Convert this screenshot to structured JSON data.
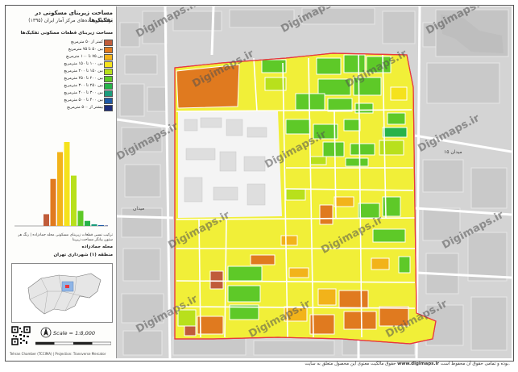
{
  "title": "مساحت زیربنای مسکونی در تفکیک‌ها",
  "subtitle": "بر اساس داده‌های مرکز آمار ایران (۱۳۹۵)",
  "legend": {
    "heading": "مساحت زیربنای قطعات مسکونی تفکیک‌ها",
    "items": [
      {
        "label": "کمتر از ۵۰ مترمربع",
        "color": "#c05c3a"
      },
      {
        "label": "بین ۵۰ تا ۷۵ مترمربع",
        "color": "#e07a1f"
      },
      {
        "label": "بین ۷۵ تا ۱۰۰ مترمربع",
        "color": "#f2b31a"
      },
      {
        "label": "بین ۱۰۰ تا ۱۵۰ مترمربع",
        "color": "#f5e21c"
      },
      {
        "label": "بین ۱۵۰ تا ۲۰۰ مترمربع",
        "color": "#b8e01c"
      },
      {
        "label": "بین ۲۰۰ تا ۲۵۰ مترمربع",
        "color": "#5ec928"
      },
      {
        "label": "بین ۲۵۰ تا ۳۰۰ مترمربع",
        "color": "#27b34a"
      },
      {
        "label": "بین ۳۰۰ تا ۴۰۰ مترمربع",
        "color": "#1a9c7c"
      },
      {
        "label": "بین ۴۰۰ تا ۵۰۰ مترمربع",
        "color": "#1f5aa6"
      },
      {
        "label": "بیشتر از ۵۰۰ مترمربع",
        "color": "#1c2c7a"
      }
    ]
  },
  "histogram": {
    "values": [
      14,
      56,
      88,
      100,
      60,
      18,
      6,
      2,
      1,
      0.5
    ],
    "caption": "ترکیب نسبی قطعات زیربنای مسکونی محله جمادزاده | رنگ هر ستون بیانگر مساحت زیربنا"
  },
  "region": "محله جمادزاده",
  "district": "منطقه (۱) شهرداری تهران",
  "scale": "Scale = 1:8,000",
  "credit": "Tehran Chamber (TCCIMA) | Projection: Transverse Mercator",
  "footer": {
    "text_before": "حقوق مالکیت معنوی این محصول متعلق به سایت",
    "site": "www.digimaps.ir",
    "text_after": "بوده و تمامی حقوق آن محفوظ است."
  },
  "watermark": "Digimaps.ir",
  "map_labels": [
    "میدان ۱۵",
    "میدان"
  ],
  "colors": {
    "boundary": "#e8383f",
    "road": "#ffffff",
    "background": "#d7d7d7",
    "gray_block": "#bdbdbd",
    "dark_block": "#a9a9a9"
  }
}
